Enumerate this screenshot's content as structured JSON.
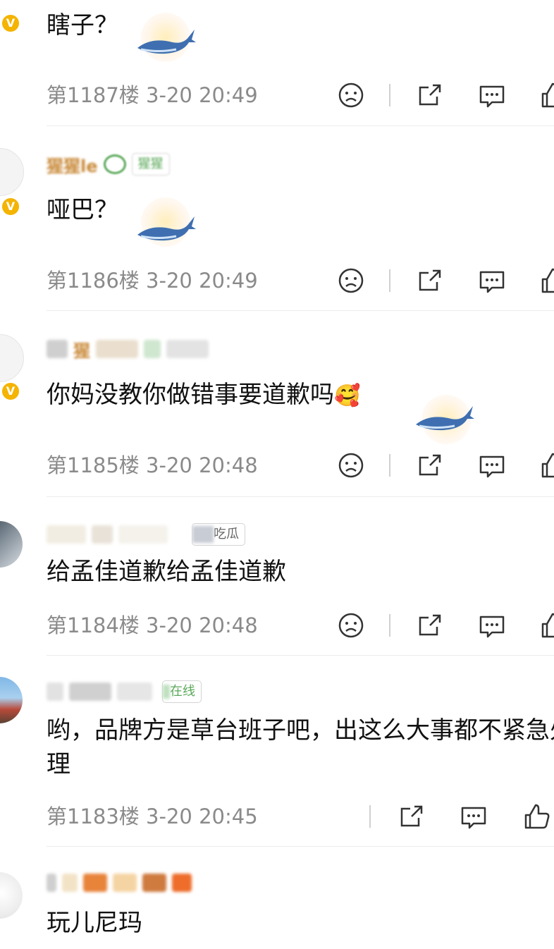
{
  "comments": [
    {
      "text": "瞎子？",
      "floor": "第1187楼",
      "time": "3-20 20:49"
    },
    {
      "username": "猩猩le",
      "tag": "猩猩",
      "text": "哑巴？",
      "floor": "第1186楼",
      "time": "3-20 20:49"
    },
    {
      "username": "猩",
      "text": "你妈没教你做错事要道歉吗",
      "emoji": "🥰",
      "floor": "第1185楼",
      "time": "3-20 20:48"
    },
    {
      "tag": "吃瓜",
      "text": "给孟佳道歉给孟佳道歉",
      "floor": "第1184楼",
      "time": "3-20 20:48"
    },
    {
      "tag": "在线",
      "text": "哟，品牌方是草台班子吧，出这么大事都不紧急处理",
      "floor": "第1183楼",
      "time": "3-20 20:45"
    },
    {
      "text": "玩儿尼玛"
    }
  ],
  "icons": {
    "dislike": "sad-face-icon",
    "share": "share-icon",
    "comment": "comment-icon",
    "like": "thumbs-up-icon",
    "verified": "verified-badge-icon"
  },
  "colors": {
    "meta_text": "#8a8a8a",
    "verified": "#f4b400",
    "divider": "#ececec"
  },
  "badge_letter": "V"
}
